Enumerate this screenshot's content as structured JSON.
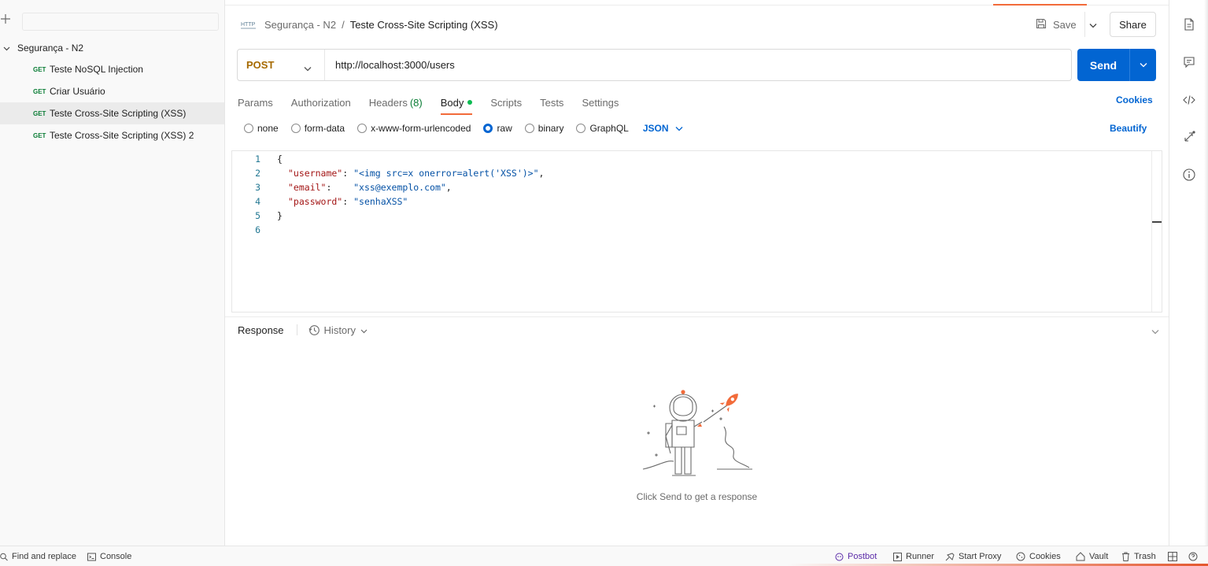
{
  "sidebar": {
    "collection_name": "Segurança - N2",
    "items": [
      {
        "method": "GET",
        "label": "Teste NoSQL Injection"
      },
      {
        "method": "GET",
        "label": "Criar Usuário"
      },
      {
        "method": "GET",
        "label": "Teste Cross-Site Scripting (XSS)"
      },
      {
        "method": "GET",
        "label": "Teste Cross-Site Scripting (XSS) 2"
      }
    ]
  },
  "header": {
    "http_badge": "HTTP",
    "breadcrumb_parent": "Segurança - N2",
    "breadcrumb_separator": "/",
    "breadcrumb_current": "Teste Cross-Site Scripting (XSS)",
    "save_label": "Save",
    "share_label": "Share"
  },
  "request": {
    "method": "POST",
    "url": "http://localhost:3000/users",
    "send_label": "Send"
  },
  "tabs": {
    "params": "Params",
    "authorization": "Authorization",
    "headers": "Headers",
    "headers_count": "(8)",
    "body": "Body",
    "scripts": "Scripts",
    "tests": "Tests",
    "settings": "Settings",
    "cookies": "Cookies"
  },
  "body_types": {
    "none": "none",
    "form_data": "form-data",
    "urlencoded": "x-www-form-urlencoded",
    "raw": "raw",
    "binary": "binary",
    "graphql": "GraphQL",
    "format": "JSON",
    "beautify": "Beautify"
  },
  "editor": {
    "lines": [
      {
        "n": "1",
        "open": "{"
      },
      {
        "n": "2",
        "key": "\"username\"",
        "colon": ": ",
        "value": "\"<img src=x onerror=alert('XSS')>\"",
        "end": ","
      },
      {
        "n": "3",
        "key": "\"email\"",
        "colon": ":    ",
        "value": "\"xss@exemplo.com\"",
        "end": ","
      },
      {
        "n": "4",
        "key": "\"password\"",
        "colon": ": ",
        "value": "\"senhaXSS\"",
        "end": ""
      },
      {
        "n": "5",
        "close": "}"
      },
      {
        "n": "6"
      }
    ]
  },
  "response": {
    "title": "Response",
    "history_label": "History",
    "empty_message": "Click Send to get a response"
  },
  "statusbar": {
    "find_replace": "Find and replace",
    "console": "Console",
    "postbot": "Postbot",
    "runner": "Runner",
    "start_proxy": "Start Proxy",
    "cookies": "Cookies",
    "vault": "Vault",
    "trash": "Trash"
  },
  "colors": {
    "accent": "#f26b3a",
    "primary": "#0265d2",
    "get_method": "#0b7d36",
    "post_method": "#a66a00"
  }
}
